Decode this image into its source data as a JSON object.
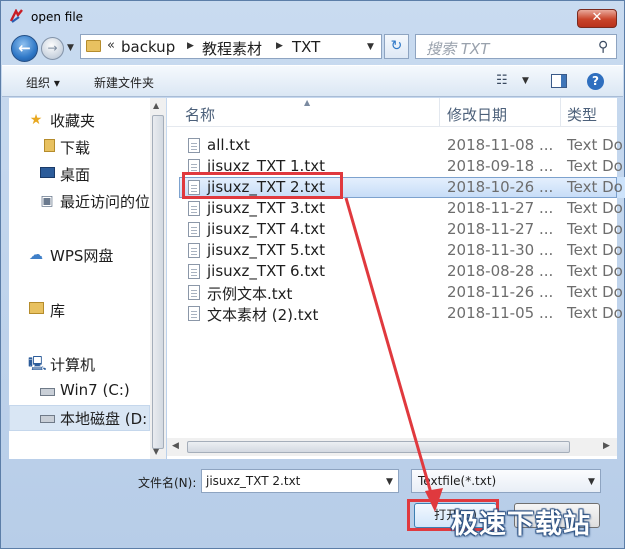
{
  "window": {
    "title": "open file",
    "close_label": "✕"
  },
  "nav": {
    "back_label": "←",
    "forward_label": "→"
  },
  "address": {
    "prefix": "«",
    "crumbs": [
      "backup",
      "教程素材",
      "TXT"
    ]
  },
  "search": {
    "placeholder": "搜索 TXT"
  },
  "toolbar": {
    "organize_label": "组织 ▾",
    "new_folder_label": "新建文件夹"
  },
  "sidebar": {
    "items": [
      {
        "label": "收藏夹",
        "icon": "star-icon"
      },
      {
        "label": "下载",
        "icon": "download-folder-icon"
      },
      {
        "label": "桌面",
        "icon": "desktop-icon"
      },
      {
        "label": "最近访问的位",
        "icon": "recent-places-icon"
      },
      {
        "label": "WPS网盘",
        "icon": "cloud-icon"
      },
      {
        "label": "库",
        "icon": "library-icon"
      },
      {
        "label": "计算机",
        "icon": "computer-icon"
      },
      {
        "label": "Win7 (C:)",
        "icon": "drive-icon"
      },
      {
        "label": "本地磁盘 (D:",
        "icon": "drive-icon"
      }
    ]
  },
  "filelist": {
    "columns": {
      "name": "名称",
      "date": "修改日期",
      "type": "类型"
    },
    "files": [
      {
        "name": "all.txt",
        "date": "2018-11-08 ...",
        "type": "Text Do"
      },
      {
        "name": "jisuxz_TXT 1.txt",
        "date": "2018-09-18 ...",
        "type": "Text Do"
      },
      {
        "name": "jisuxz_TXT 2.txt",
        "date": "2018-10-26 ...",
        "type": "Text Do"
      },
      {
        "name": "jisuxz_TXT 3.txt",
        "date": "2018-11-27 ...",
        "type": "Text Do"
      },
      {
        "name": "jisuxz_TXT 4.txt",
        "date": "2018-11-27 ...",
        "type": "Text Do"
      },
      {
        "name": "jisuxz_TXT 5.txt",
        "date": "2018-11-30 ...",
        "type": "Text Do"
      },
      {
        "name": "jisuxz_TXT 6.txt",
        "date": "2018-08-28 ...",
        "type": "Text Do"
      },
      {
        "name": "示例文本.txt",
        "date": "2018-11-26 ...",
        "type": "Text Do"
      },
      {
        "name": "文本素材 (2).txt",
        "date": "2018-11-05 ...",
        "type": "Text Do"
      }
    ],
    "selected_index": 2
  },
  "footer": {
    "filename_label": "文件名(N):",
    "filename_value": "jisuxz_TXT 2.txt",
    "filetype_value": "Textfile(*.txt)",
    "open_label": "打开(O)",
    "cancel_label": ""
  },
  "watermark": "极速下载站",
  "colors": {
    "annotation_red": "#e0393e",
    "selection": "#cde3fb",
    "accent": "#2f78c7"
  }
}
